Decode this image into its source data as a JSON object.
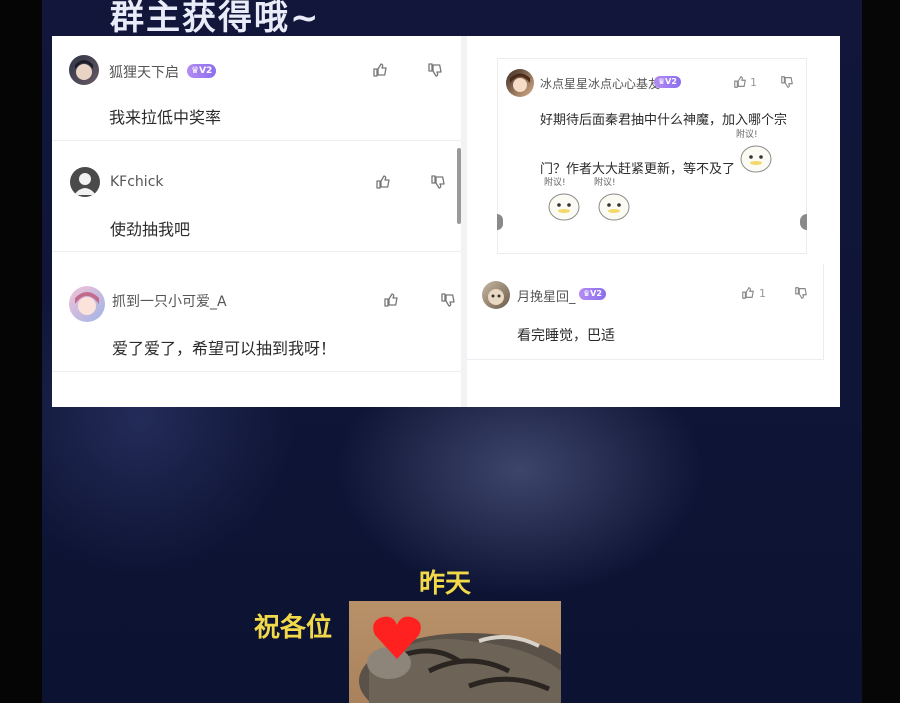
{
  "header": {
    "title": "群主获得哦~"
  },
  "comments_left": [
    {
      "username": "狐狸天下启",
      "badge": "V2",
      "text": "我来拉低中奖率"
    },
    {
      "username": "KFchick",
      "text": "使劲抽我吧"
    },
    {
      "username": "抓到一只小可爱_A",
      "text": "爱了爱了，希望可以抽到我呀！"
    }
  ],
  "comments_right": [
    {
      "username": "冰点星星冰点心心基友",
      "badge": "V2",
      "like_count": "1",
      "text_line1": "好期待后面秦君抽中什么神魔，加入哪个宗",
      "text_line2": "门？作者大大赶紧更新，等不及了",
      "stickers": [
        "附议!",
        "附议!",
        "附议!"
      ]
    },
    {
      "username": "月挽星回_",
      "badge": "V2",
      "like_count": "1",
      "text": "看完睡觉，巴适"
    }
  ],
  "caption": {
    "word1": "昨天",
    "word2": "祝各位"
  },
  "icons": {
    "like": "thumbs-up-icon",
    "dislike": "thumbs-down-icon",
    "heart": "heart-icon"
  },
  "colors": {
    "caption": "#f2d94a",
    "badge": "#8a6df0",
    "heart": "#ff2020"
  }
}
